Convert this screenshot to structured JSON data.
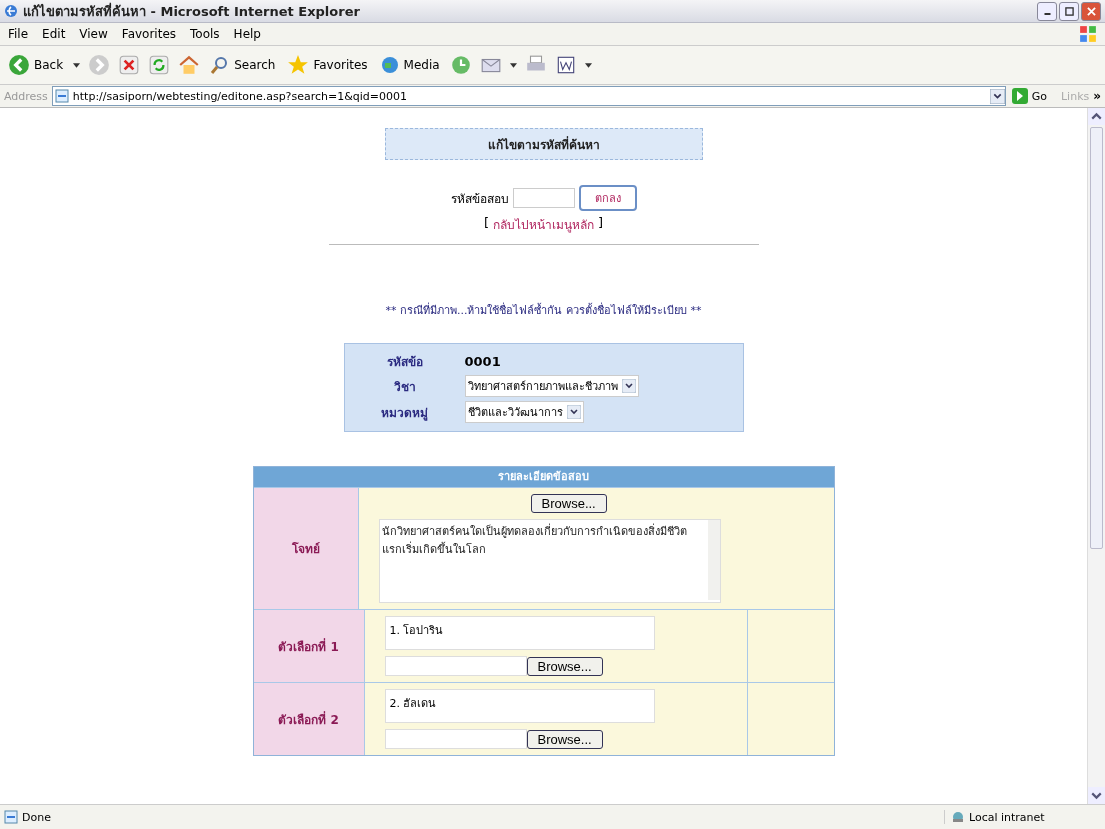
{
  "window": {
    "title": "แก้ไขตามรหัสที่ค้นหา - Microsoft Internet Explorer"
  },
  "menu_bar": [
    "File",
    "Edit",
    "View",
    "Favorites",
    "Tools",
    "Help"
  ],
  "toolbar": {
    "back": "Back",
    "search": "Search",
    "favorites": "Favorites",
    "media": "Media"
  },
  "address_bar": {
    "label": "Address",
    "url": "http://sasiporn/webtesting/editone.asp?search=1&qid=0001",
    "go": "Go",
    "links": "Links",
    "links_chevron": "»"
  },
  "page": {
    "heading": "แก้ไขตามรหัสที่ค้นหา",
    "search": {
      "label": "รหัสข้อสอบ",
      "button": "ตกลง"
    },
    "back_link": {
      "open": "[",
      "text": "กลับไปหน้าเมนูหลัก",
      "close": "]"
    },
    "note": "** กรณีที่มีภาพ...ห้ามใช้ชื่อไฟล์ซ้ำกัน ควรตั้งชื่อไฟล์ให้มีระเบียบ **",
    "info": [
      {
        "label": "รหัสข้อ",
        "kind": "text",
        "value": "0001"
      },
      {
        "label": "วิชา",
        "kind": "select",
        "value": "วิทยาศาสตร์กายภาพและชีวภาพ"
      },
      {
        "label": "หมวดหมู่",
        "kind": "select",
        "value": "ชีวิตและวิวัฒนาการ"
      }
    ],
    "details": {
      "title": "รายละเอียดข้อสอบ",
      "question": {
        "label": "โจทย์",
        "browse": "Browse...",
        "text": "นักวิทยาศาสตร์คนใดเป็นผู้ทดลองเกี่ยวกับการกำเนิดของสิ่งมีชีวิตแรกเริ่มเกิดขึ้นในโลก"
      },
      "choices": [
        {
          "label": "ตัวเลือกที่ 1",
          "text": "1. โอปาริน",
          "browse": "Browse..."
        },
        {
          "label": "ตัวเลือกที่ 2",
          "text": "2. ฮัลเดน",
          "browse": "Browse..."
        }
      ]
    }
  },
  "status_bar": {
    "text": "Done",
    "zone": "Local intranet"
  }
}
